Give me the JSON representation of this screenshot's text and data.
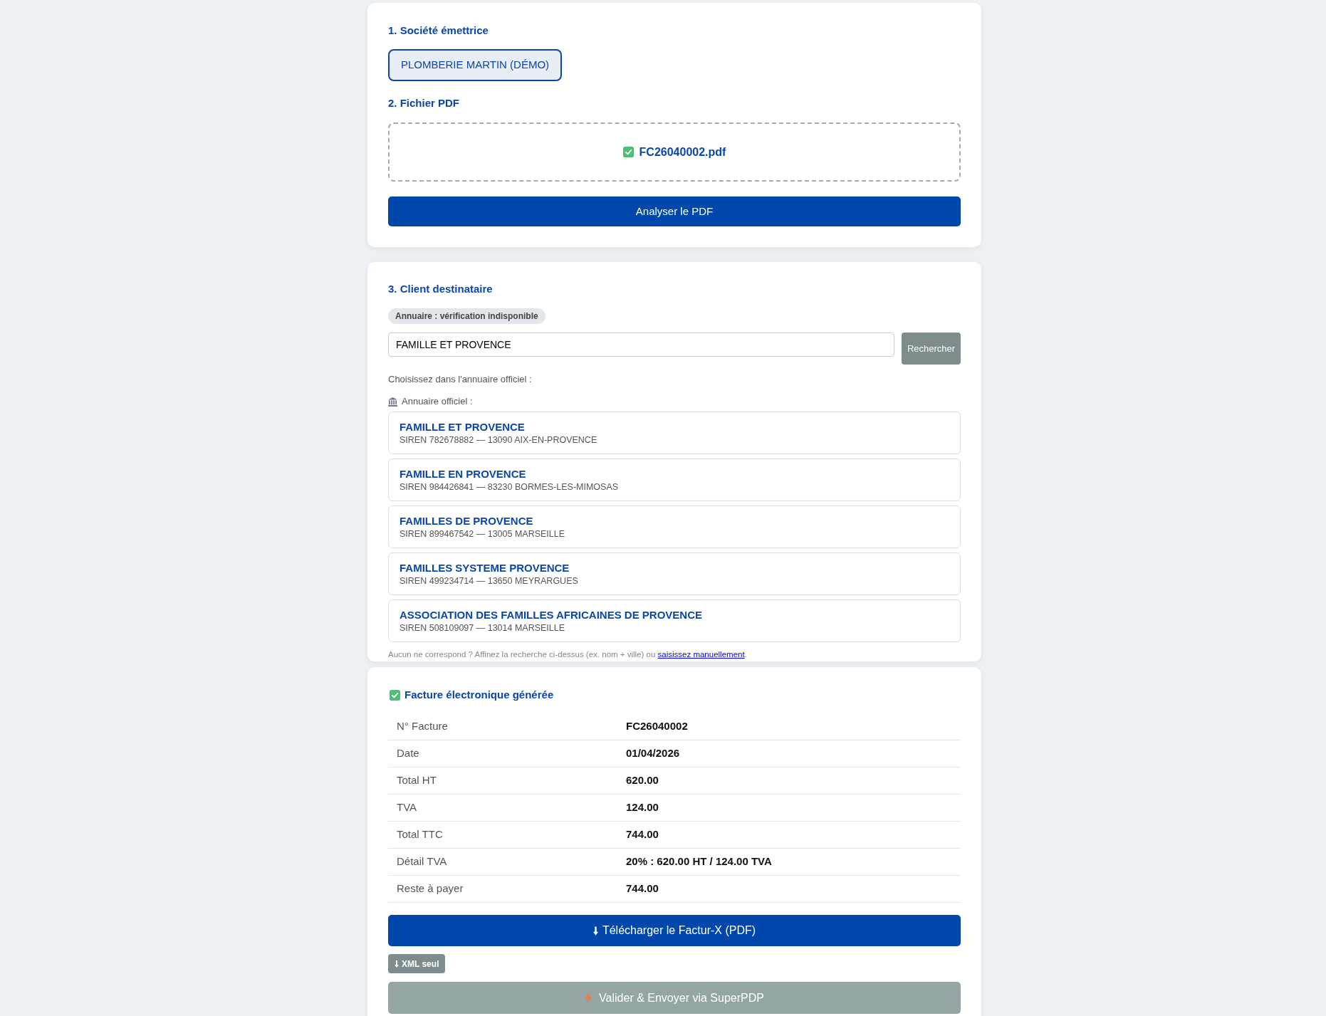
{
  "issuer_section": {
    "heading": "1. Société émettrice",
    "companies": [
      {
        "label": "PLOMBERIE MARTIN (DÉMO)",
        "selected": true
      }
    ]
  },
  "pdf_section": {
    "heading": "2. Fichier PDF",
    "file_name": "FC26040002.pdf",
    "analyze_button": "Analyser le PDF"
  },
  "client_section": {
    "heading": "3. Client destinataire",
    "directory_badge": "Annuaire : vérification indisponible",
    "search": {
      "value": "FAMILLE ET PROVENCE"
    },
    "search_button": "Rechercher",
    "prompt": "Choisissez dans l'annuaire officiel :",
    "source_label": "Annuaire officiel :",
    "results": [
      {
        "name": "FAMILLE ET PROVENCE",
        "detail": "SIREN 782678882 — 13090 AIX-EN-PROVENCE"
      },
      {
        "name": "FAMILLE EN PROVENCE",
        "detail": "SIREN 984426841 — 83230 BORMES-LES-MIMOSAS"
      },
      {
        "name": "FAMILLES DE PROVENCE",
        "detail": "SIREN 899467542 — 13005 MARSEILLE"
      },
      {
        "name": "FAMILLES SYSTEME PROVENCE",
        "detail": "SIREN 499234714 — 13650 MEYRARGUES"
      },
      {
        "name": "ASSOCIATION DES FAMILLES AFRICAINES DE PROVENCE",
        "detail": "SIREN 508109097 — 13014 MARSEILLE"
      }
    ],
    "footnote": {
      "text_before": "Aucun ne correspond ? Affinez la recherche ci-dessus (ex. nom + ville) ou",
      "link": "saisissez manuellement",
      "text_after": "."
    }
  },
  "invoice": {
    "title": "Facture électronique générée",
    "rows": [
      {
        "label": "N° Facture",
        "value": "FC26040002"
      },
      {
        "label": "Date",
        "value": "01/04/2026"
      },
      {
        "label": "Total HT",
        "value": "620.00"
      },
      {
        "label": "TVA",
        "value": "124.00"
      },
      {
        "label": "Total TTC",
        "value": "744.00"
      },
      {
        "label": "Détail TVA",
        "value": "20% : 620.00 HT / 124.00 TVA"
      },
      {
        "label": "Reste à payer",
        "value": "744.00"
      }
    ],
    "download_button": "Télécharger le Factur-X (PDF)",
    "xml_button": "XML seul",
    "send_button": {
      "label": "Valider & Envoyer via SuperPDP",
      "disabled": true
    }
  }
}
